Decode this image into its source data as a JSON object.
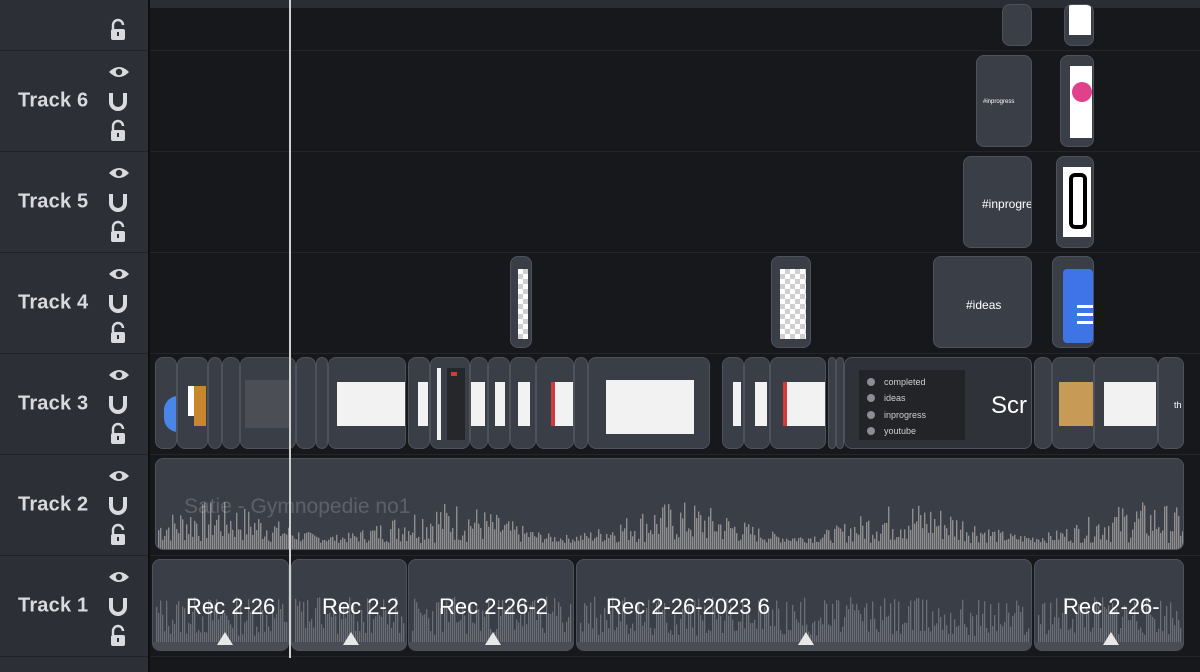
{
  "tracks": [
    {
      "label": "Track 6"
    },
    {
      "label": "Track 5"
    },
    {
      "label": "Track 4"
    },
    {
      "label": "Track 3"
    },
    {
      "label": "Track 2"
    },
    {
      "label": "Track 1"
    }
  ],
  "clips": {
    "track6_text": "#inprogress",
    "track5_text": "#inprogre",
    "track4_text": "#ideas",
    "track3_scr": "Scr",
    "track3_th": "th",
    "track2_audio": "Satie - Gymnopedie no1",
    "track1_recs": [
      "Rec 2-26",
      "Rec 2-2",
      "Rec 2-26-2",
      "Rec 2-26-2023 6",
      "Rec 2-26-"
    ]
  },
  "menu": {
    "items": [
      "completed",
      "ideas",
      "inprogress",
      "youtube"
    ]
  },
  "colors": {
    "background": "#17181b",
    "header": "#2c2f36",
    "clip": "#3a3e47",
    "waveform": "#8e8e8e",
    "playhead": "#d0d0d0"
  }
}
